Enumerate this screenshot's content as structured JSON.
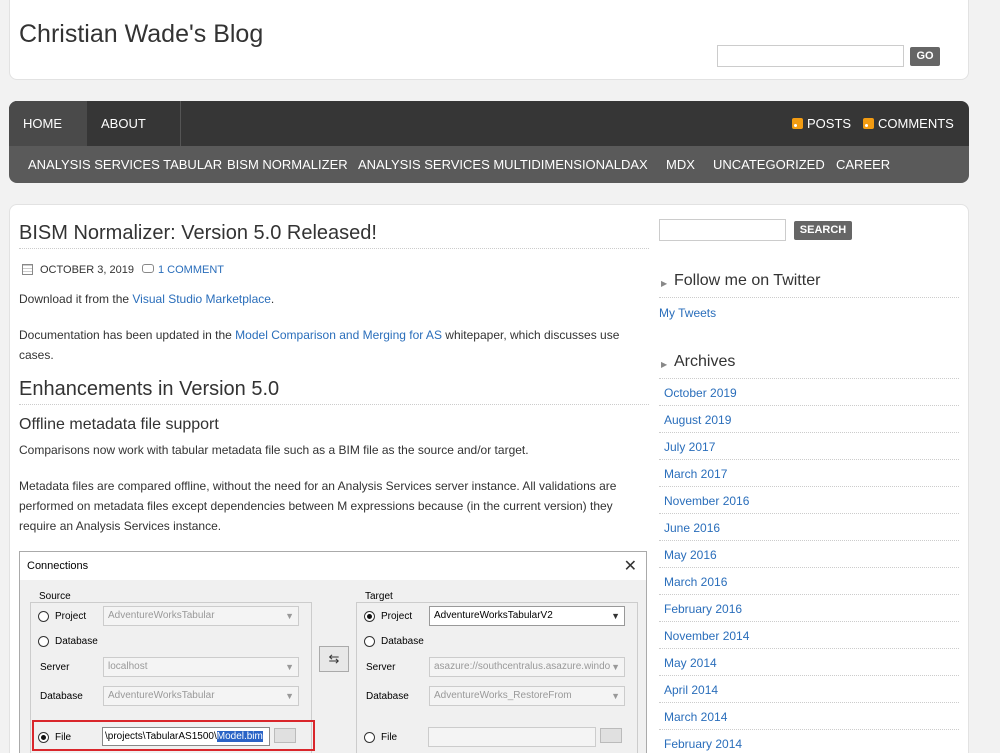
{
  "blog": {
    "title": "Christian Wade's Blog",
    "go_label": "GO"
  },
  "nav": {
    "tabs": [
      {
        "label": "HOME"
      },
      {
        "label": "ABOUT ME"
      }
    ],
    "feeds": {
      "posts": "POSTS",
      "comments": "COMMENTS"
    },
    "categories": [
      "ANALYSIS SERVICES TABULAR",
      "BISM NORMALIZER",
      "ANALYSIS SERVICES MULTIDIMENSIONAL",
      "DAX",
      "MDX",
      "UNCATEGORIZED",
      "CAREER"
    ]
  },
  "post": {
    "title": "BISM Normalizer: Version 5.0 Released!",
    "date": "OCTOBER 3, 2019",
    "comments": "1 COMMENT",
    "p1_pre": "Download it from the ",
    "p1_link": "Visual Studio Marketplace",
    "p1_post": ".",
    "p2_pre": "Documentation has been updated in the ",
    "p2_link": "Model Comparison and Merging for AS",
    "p2_post": " whitepaper, which discusses use cases.",
    "h2": "Enhancements in Version 5.0",
    "h3": "Offline metadata file support",
    "p3": "Comparisons now work with tabular metadata file such as a BIM file as the source and/or target.",
    "p4": "Metadata files are compared offline, without the need for an Analysis Services server instance. All validations are performed on metadata files except dependencies between M expressions because (in the current version) they require an Analysis Services instance."
  },
  "dialog": {
    "title": "Connections",
    "source": {
      "label": "Source",
      "project_label": "Project",
      "project_value": "AdventureWorksTabular",
      "database_radio": "Database",
      "server_label": "Server",
      "server_value": "localhost",
      "database_label": "Database",
      "database_value": "AdventureWorksTabular",
      "file_label": "File",
      "file_path": "\\projects\\TabularAS1500\\",
      "file_selected": "Model.bim"
    },
    "target": {
      "label": "Target",
      "project_label": "Project",
      "project_value": "AdventureWorksTabularV2",
      "database_radio": "Database",
      "server_label": "Server",
      "server_value": "asazure://southcentralus.asazure.windo",
      "database_label": "Database",
      "database_value": "AdventureWorks_RestoreFrom",
      "file_label": "File"
    },
    "swap_symbol": "⇆",
    "close_symbol": "✕"
  },
  "sidebar": {
    "search_label": "SEARCH",
    "twitter_title": "Follow me on Twitter",
    "tweets_link": "My Tweets",
    "archives_title": "Archives",
    "archives": [
      "October 2019",
      "August 2019",
      "July 2017",
      "March 2017",
      "November 2016",
      "June 2016",
      "May 2016",
      "March 2016",
      "February 2016",
      "November 2014",
      "May 2014",
      "April 2014",
      "March 2014",
      "February 2014"
    ]
  }
}
